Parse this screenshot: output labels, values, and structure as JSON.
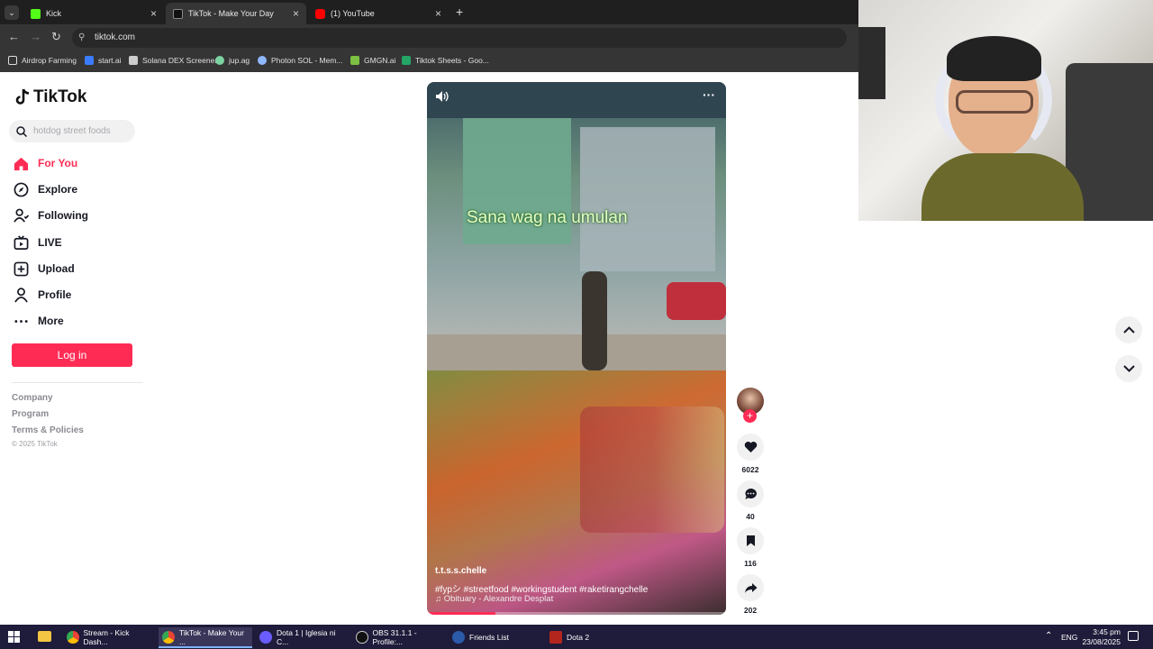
{
  "browser": {
    "tabs": [
      {
        "title": "Kick",
        "icon": "kick-icon",
        "color": "#53fc18"
      },
      {
        "title": "TikTok - Make Your Day",
        "icon": "tiktok-icon",
        "color": "#ffffff"
      },
      {
        "title": "(1) YouTube",
        "icon": "youtube-icon",
        "color": "#ff0000"
      }
    ],
    "url": "tiktok.com",
    "bookmarks": [
      "Airdrop Farming",
      "start.ai",
      "Solana DEX Screener",
      "jup.ag",
      "Photon SOL - Mem...",
      "GMGN.ai",
      "Tiktok Sheets - Goo..."
    ]
  },
  "tiktok": {
    "logo": "TikTok",
    "search_placeholder": "hotdog street foods",
    "nav": [
      {
        "label": "For You",
        "icon": "home-icon"
      },
      {
        "label": "Explore",
        "icon": "compass-icon"
      },
      {
        "label": "Following",
        "icon": "following-icon"
      },
      {
        "label": "LIVE",
        "icon": "live-icon"
      },
      {
        "label": "Upload",
        "icon": "upload-icon"
      },
      {
        "label": "Profile",
        "icon": "profile-icon"
      },
      {
        "label": "More",
        "icon": "more-icon"
      }
    ],
    "login_label": "Log in",
    "footer": [
      "Company",
      "Program",
      "Terms & Policies"
    ],
    "copyright": "© 2025 TikTok",
    "accent": "#fe2c55"
  },
  "video": {
    "overlay_text": "Sana wag na umulan",
    "author": "t.t.s.s.chelle",
    "caption": "#fypシ #streetfood #workingstudent #raketirangchelle",
    "music": "Obituary - Alexandre Desplat",
    "likes": "6022",
    "comments": "40",
    "bookmarks": "116",
    "shares": "202",
    "progress": 0.23
  },
  "taskbar": {
    "items": [
      "Stream - Kick Dash...",
      "TikTok - Make Your ...",
      "Dota 1 | Iglesia ni C...",
      "OBS 31.1.1 - Profile:...",
      "Friends List",
      "Dota 2"
    ],
    "lang": "ENG",
    "time": "3:45 pm",
    "date": "23/08/2025"
  }
}
